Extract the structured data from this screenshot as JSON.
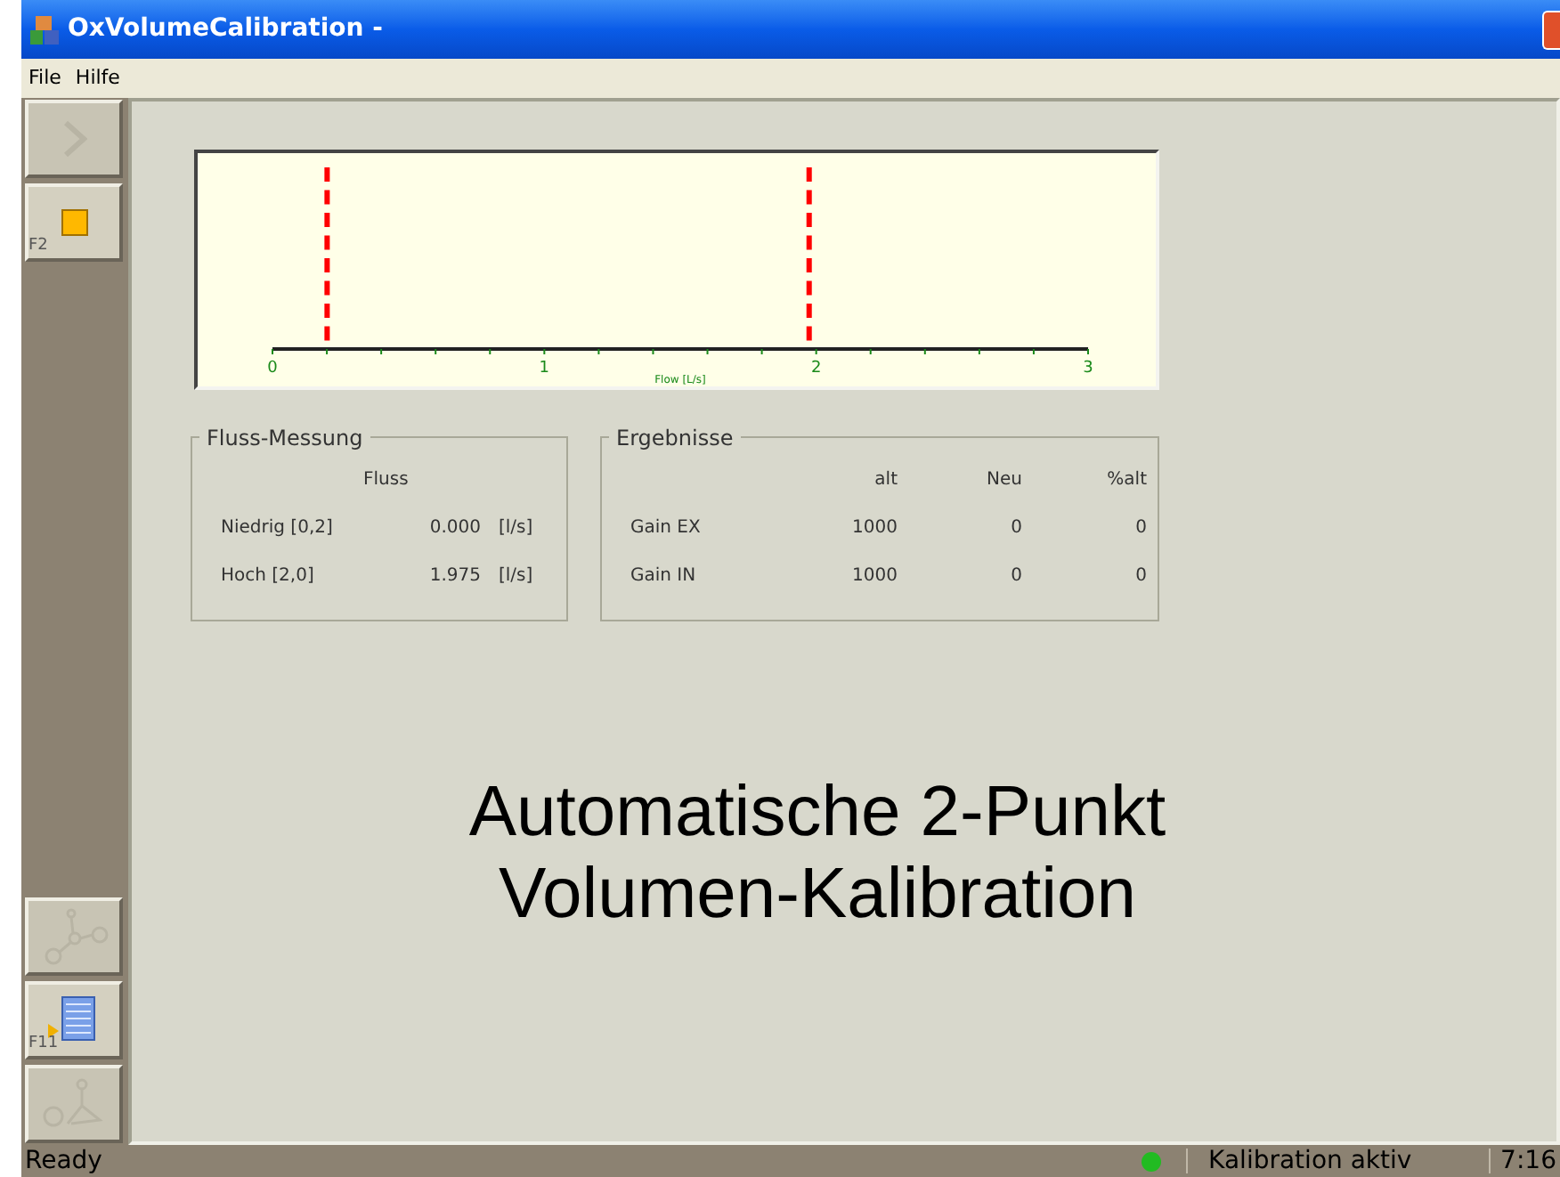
{
  "window": {
    "title": "OxVolumeCalibration -"
  },
  "menu": [
    "File",
    "Hilfe"
  ],
  "toolbar": [
    {
      "kind": "play",
      "disabled": true
    },
    {
      "kind": "stop",
      "disabled": false,
      "key": "F2"
    },
    {
      "kind": "graph",
      "disabled": true
    },
    {
      "kind": "list",
      "disabled": false,
      "key": "F11"
    },
    {
      "kind": "person",
      "disabled": true
    }
  ],
  "flow_plot": {
    "axis_title": "Flow [L/s]",
    "tick_labels": [
      "0",
      "1",
      "2",
      "3"
    ],
    "markers": [
      {
        "level": 0.067
      },
      {
        "level": 0.658
      }
    ]
  },
  "flow_group": {
    "title": "Fluss-Messung",
    "column": "Fluss",
    "rows": [
      {
        "label": "Niedrig [0,2]",
        "value": "0.000",
        "unit": "[l/s]"
      },
      {
        "label": "Hoch [2,0]",
        "value": "1.975",
        "unit": "[l/s]"
      }
    ]
  },
  "results_group": {
    "title": "Ergebnisse",
    "columns": [
      "alt",
      "Neu",
      "%alt"
    ],
    "rows": [
      {
        "label": "Gain EX",
        "values": [
          "1000",
          "0",
          "0"
        ]
      },
      {
        "label": "Gain IN",
        "values": [
          "1000",
          "0",
          "0"
        ]
      }
    ]
  },
  "caption": [
    "Automatische 2-Punkt",
    "Volumen-Kalibration"
  ],
  "status_bar": {
    "text": "Ready",
    "indicator_on": true,
    "status": "Kalibration aktiv",
    "time": "7:16"
  }
}
